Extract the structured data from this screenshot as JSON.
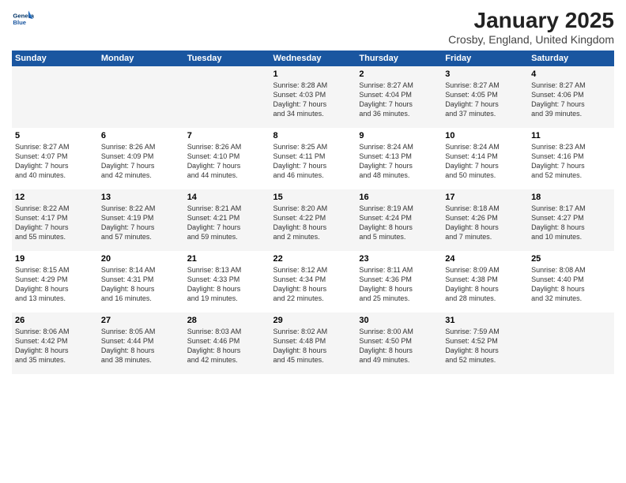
{
  "logo": {
    "name": "General",
    "name2": "Blue"
  },
  "title": "January 2025",
  "location": "Crosby, England, United Kingdom",
  "days_header": [
    "Sunday",
    "Monday",
    "Tuesday",
    "Wednesday",
    "Thursday",
    "Friday",
    "Saturday"
  ],
  "weeks": [
    [
      {
        "day": "",
        "content": ""
      },
      {
        "day": "",
        "content": ""
      },
      {
        "day": "",
        "content": ""
      },
      {
        "day": "1",
        "content": "Sunrise: 8:28 AM\nSunset: 4:03 PM\nDaylight: 7 hours\nand 34 minutes."
      },
      {
        "day": "2",
        "content": "Sunrise: 8:27 AM\nSunset: 4:04 PM\nDaylight: 7 hours\nand 36 minutes."
      },
      {
        "day": "3",
        "content": "Sunrise: 8:27 AM\nSunset: 4:05 PM\nDaylight: 7 hours\nand 37 minutes."
      },
      {
        "day": "4",
        "content": "Sunrise: 8:27 AM\nSunset: 4:06 PM\nDaylight: 7 hours\nand 39 minutes."
      }
    ],
    [
      {
        "day": "5",
        "content": "Sunrise: 8:27 AM\nSunset: 4:07 PM\nDaylight: 7 hours\nand 40 minutes."
      },
      {
        "day": "6",
        "content": "Sunrise: 8:26 AM\nSunset: 4:09 PM\nDaylight: 7 hours\nand 42 minutes."
      },
      {
        "day": "7",
        "content": "Sunrise: 8:26 AM\nSunset: 4:10 PM\nDaylight: 7 hours\nand 44 minutes."
      },
      {
        "day": "8",
        "content": "Sunrise: 8:25 AM\nSunset: 4:11 PM\nDaylight: 7 hours\nand 46 minutes."
      },
      {
        "day": "9",
        "content": "Sunrise: 8:24 AM\nSunset: 4:13 PM\nDaylight: 7 hours\nand 48 minutes."
      },
      {
        "day": "10",
        "content": "Sunrise: 8:24 AM\nSunset: 4:14 PM\nDaylight: 7 hours\nand 50 minutes."
      },
      {
        "day": "11",
        "content": "Sunrise: 8:23 AM\nSunset: 4:16 PM\nDaylight: 7 hours\nand 52 minutes."
      }
    ],
    [
      {
        "day": "12",
        "content": "Sunrise: 8:22 AM\nSunset: 4:17 PM\nDaylight: 7 hours\nand 55 minutes."
      },
      {
        "day": "13",
        "content": "Sunrise: 8:22 AM\nSunset: 4:19 PM\nDaylight: 7 hours\nand 57 minutes."
      },
      {
        "day": "14",
        "content": "Sunrise: 8:21 AM\nSunset: 4:21 PM\nDaylight: 7 hours\nand 59 minutes."
      },
      {
        "day": "15",
        "content": "Sunrise: 8:20 AM\nSunset: 4:22 PM\nDaylight: 8 hours\nand 2 minutes."
      },
      {
        "day": "16",
        "content": "Sunrise: 8:19 AM\nSunset: 4:24 PM\nDaylight: 8 hours\nand 5 minutes."
      },
      {
        "day": "17",
        "content": "Sunrise: 8:18 AM\nSunset: 4:26 PM\nDaylight: 8 hours\nand 7 minutes."
      },
      {
        "day": "18",
        "content": "Sunrise: 8:17 AM\nSunset: 4:27 PM\nDaylight: 8 hours\nand 10 minutes."
      }
    ],
    [
      {
        "day": "19",
        "content": "Sunrise: 8:15 AM\nSunset: 4:29 PM\nDaylight: 8 hours\nand 13 minutes."
      },
      {
        "day": "20",
        "content": "Sunrise: 8:14 AM\nSunset: 4:31 PM\nDaylight: 8 hours\nand 16 minutes."
      },
      {
        "day": "21",
        "content": "Sunrise: 8:13 AM\nSunset: 4:33 PM\nDaylight: 8 hours\nand 19 minutes."
      },
      {
        "day": "22",
        "content": "Sunrise: 8:12 AM\nSunset: 4:34 PM\nDaylight: 8 hours\nand 22 minutes."
      },
      {
        "day": "23",
        "content": "Sunrise: 8:11 AM\nSunset: 4:36 PM\nDaylight: 8 hours\nand 25 minutes."
      },
      {
        "day": "24",
        "content": "Sunrise: 8:09 AM\nSunset: 4:38 PM\nDaylight: 8 hours\nand 28 minutes."
      },
      {
        "day": "25",
        "content": "Sunrise: 8:08 AM\nSunset: 4:40 PM\nDaylight: 8 hours\nand 32 minutes."
      }
    ],
    [
      {
        "day": "26",
        "content": "Sunrise: 8:06 AM\nSunset: 4:42 PM\nDaylight: 8 hours\nand 35 minutes."
      },
      {
        "day": "27",
        "content": "Sunrise: 8:05 AM\nSunset: 4:44 PM\nDaylight: 8 hours\nand 38 minutes."
      },
      {
        "day": "28",
        "content": "Sunrise: 8:03 AM\nSunset: 4:46 PM\nDaylight: 8 hours\nand 42 minutes."
      },
      {
        "day": "29",
        "content": "Sunrise: 8:02 AM\nSunset: 4:48 PM\nDaylight: 8 hours\nand 45 minutes."
      },
      {
        "day": "30",
        "content": "Sunrise: 8:00 AM\nSunset: 4:50 PM\nDaylight: 8 hours\nand 49 minutes."
      },
      {
        "day": "31",
        "content": "Sunrise: 7:59 AM\nSunset: 4:52 PM\nDaylight: 8 hours\nand 52 minutes."
      },
      {
        "day": "",
        "content": ""
      }
    ]
  ]
}
